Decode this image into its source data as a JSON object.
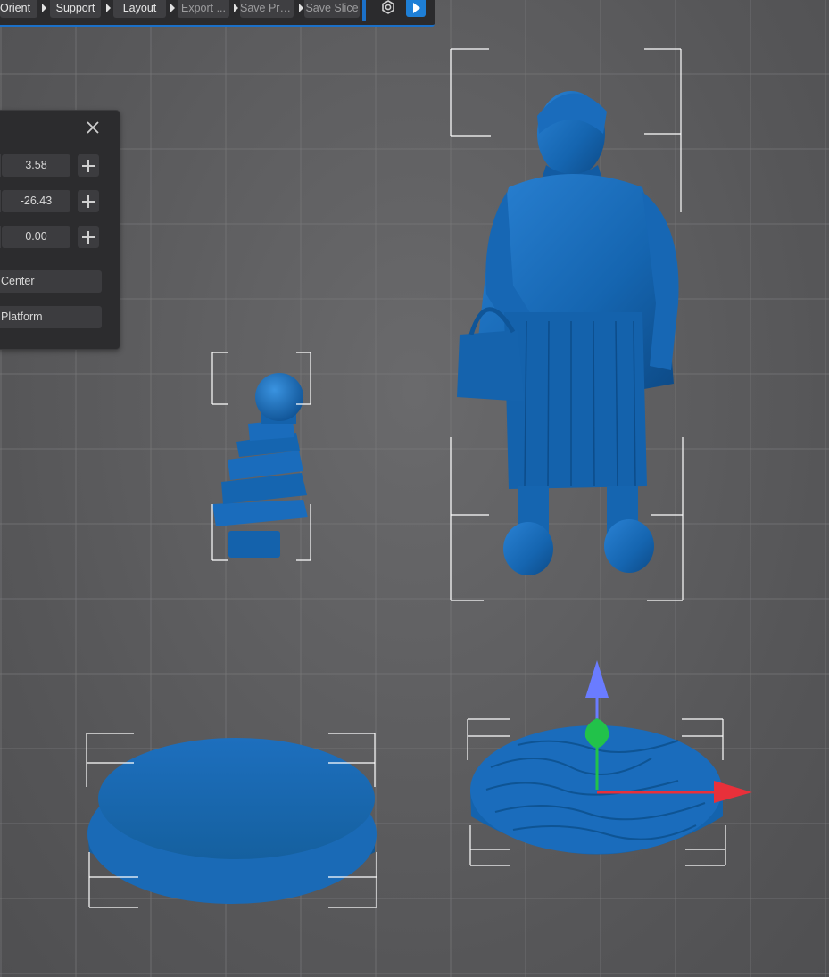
{
  "toolbar": {
    "steps": [
      {
        "label": "Orient"
      },
      {
        "label": "Support"
      },
      {
        "label": "Layout"
      },
      {
        "label": "Export ..."
      },
      {
        "label": "Save Pro..."
      },
      {
        "label": "Save Slice"
      }
    ],
    "settings_icon": "settings-icon",
    "play_icon": "play-icon",
    "accent_color": "#1b70c8"
  },
  "panel": {
    "close_icon": "close-icon",
    "fields": [
      {
        "value": "3.58"
      },
      {
        "value": "-26.43"
      },
      {
        "value": "0.00"
      }
    ],
    "center_label": "Center",
    "platform_label": "Platform"
  },
  "viewport": {
    "model_color": "#1565b0",
    "gizmo_colors": {
      "x": "#e8303a",
      "y": "#22c24a",
      "z": "#6a7cff"
    }
  }
}
